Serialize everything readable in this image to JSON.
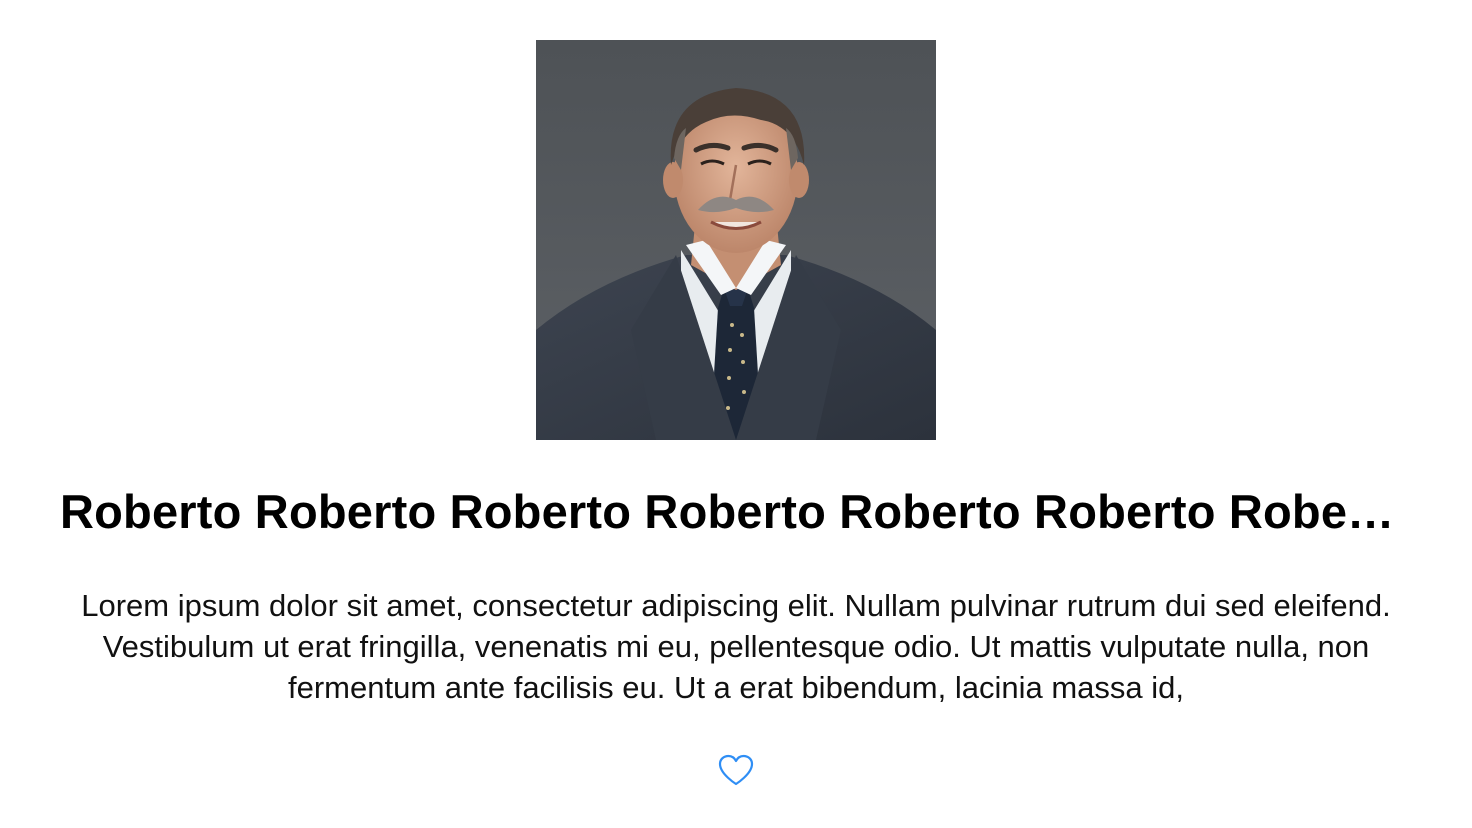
{
  "profile": {
    "name": "Roberto Roberto Roberto Roberto Roberto Roberto Roberto Roberto Roberto",
    "bio": "Lorem ipsum dolor sit amet, consectetur adipiscing elit. Nullam pulvinar rutrum dui sed eleifend. Vestibulum ut erat fringilla, venenatis mi eu, pellentesque odio. Ut mattis vulputate nulla, non fermentum ante facilisis eu. Ut a erat bibendum, lacinia massa id,",
    "photo": {
      "subject": "portrait-photo"
    }
  },
  "favorite": {
    "icon": "heart-outline-icon",
    "state": "not-favorited",
    "color": "#2f8ef5"
  }
}
